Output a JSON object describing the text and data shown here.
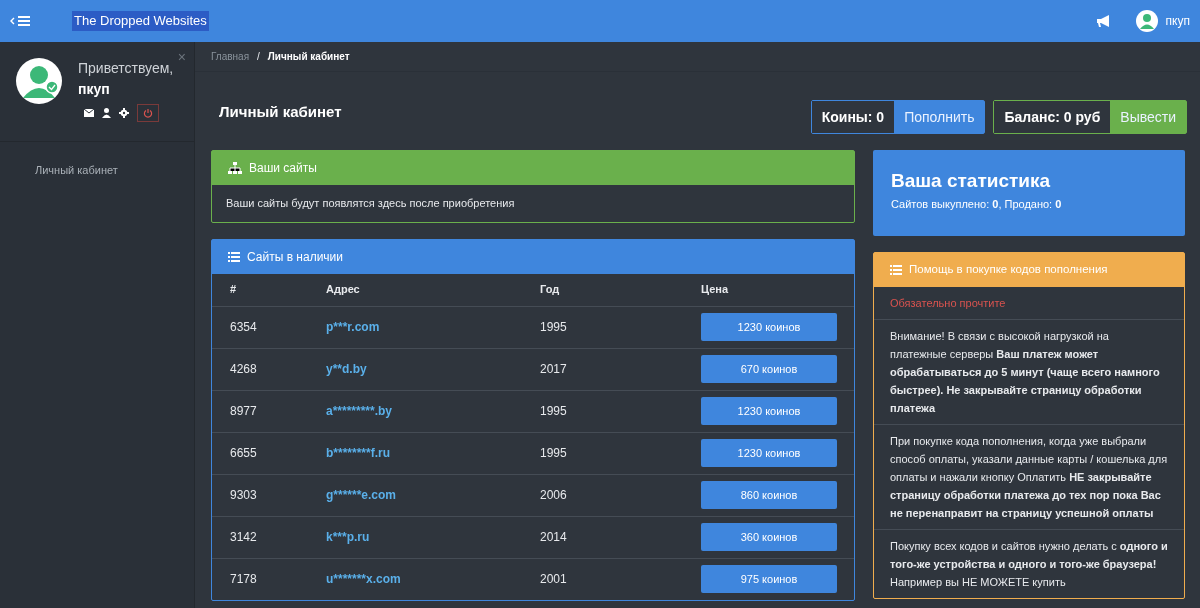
{
  "navbar": {
    "brand": "The Dropped Websites",
    "user": "пкуп"
  },
  "sidebar": {
    "greeting": "Приветствуем,",
    "username": "пкуп",
    "close": "×",
    "items": [
      {
        "label": "Личный кабинет",
        "selected": false
      }
    ]
  },
  "breadcrumb": {
    "separator": "/",
    "items": [
      {
        "label": "Главная",
        "active": false
      },
      {
        "label": "Личный кабинет",
        "active": true
      }
    ]
  },
  "page_title": "Личный кабинет",
  "wallets": [
    {
      "label": "Коины: 0",
      "action": "Пополнить",
      "color": "#3f86dd"
    },
    {
      "label": "Баланс: 0 руб",
      "action": "Вывести",
      "color": "#6ab04c"
    }
  ],
  "my_sites": {
    "title": "Ваши сайты",
    "text": "Ваши сайты будут появлятся здесь после приобретения"
  },
  "available": {
    "title": "Сайты в наличии",
    "columns": [
      "#",
      "Адрес",
      "Год",
      "Цена"
    ],
    "rows": [
      {
        "id": "6354",
        "address": "p***r.com",
        "year": "1995",
        "price": "1230 коинов"
      },
      {
        "id": "4268",
        "address": "y**d.by",
        "year": "2017",
        "price": "670 коинов"
      },
      {
        "id": "8977",
        "address": "a*********.by",
        "year": "1995",
        "price": "1230 коинов"
      },
      {
        "id": "6655",
        "address": "b********f.ru",
        "year": "1995",
        "price": "1230 коинов"
      },
      {
        "id": "9303",
        "address": "g******e.com",
        "year": "2006",
        "price": "860 коинов"
      },
      {
        "id": "3142",
        "address": "k***p.ru",
        "year": "2014",
        "price": "360 коинов"
      },
      {
        "id": "7178",
        "address": "u*******x.com",
        "year": "2001",
        "price": "975 коинов"
      }
    ]
  },
  "stats": {
    "title": "Ваша статистика",
    "text": "Сайтов выкуплено: **0**, Продано: **0**"
  },
  "help": {
    "title": "Помощь в покупке кодов пополнения",
    "notice": "Обязательно прочтите",
    "paragraphs": [
      "Внимание! В связи с высокой нагрузкой на платежные серверы **Ваш платеж может обрабатываться до 5 минут (чаще всего намного быстрее). Не закрывайте страницу обработки платежа**",
      "При покупке кода пополнения, когда уже выбрали способ оплаты, указали данные карты / кошелька для оплаты и нажали кнопку Оплатить **НЕ закрывайте страницу обработки платежа до тех пор пока Вас не перенаправит на страницу успешной оплаты**",
      "Покупку всех кодов и сайтов нужно делать с **одного и того-же устройства и одного и того-же браузера!** Например вы НЕ МОЖЕТЕ купить"
    ]
  }
}
